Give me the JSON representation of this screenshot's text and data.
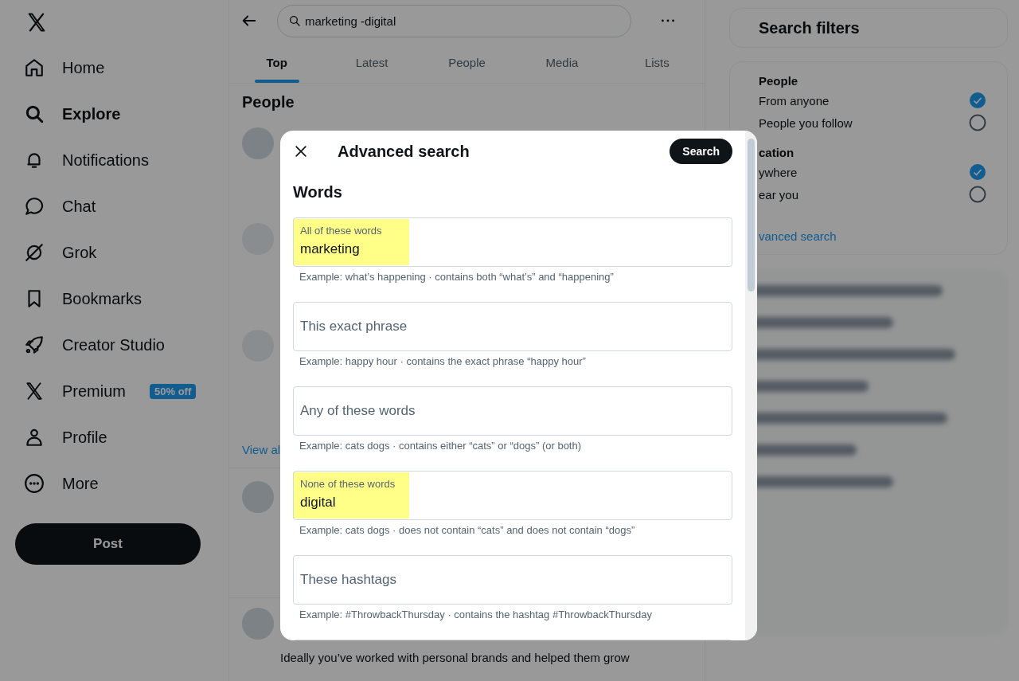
{
  "sidebar": {
    "items": [
      {
        "label": "Home",
        "selected": false
      },
      {
        "label": "Explore",
        "selected": true
      },
      {
        "label": "Notifications",
        "selected": false
      },
      {
        "label": "Chat",
        "selected": false
      },
      {
        "label": "Grok",
        "selected": false
      },
      {
        "label": "Bookmarks",
        "selected": false
      },
      {
        "label": "Creator Studio",
        "selected": false
      },
      {
        "label": "Premium",
        "selected": false,
        "badge": "50% off"
      },
      {
        "label": "Profile",
        "selected": false
      },
      {
        "label": "More",
        "selected": false
      }
    ],
    "post_button": "Post"
  },
  "search": {
    "value": "marketing -digital"
  },
  "tabs": [
    {
      "label": "Top",
      "selected": true
    },
    {
      "label": "Latest",
      "selected": false
    },
    {
      "label": "People",
      "selected": false
    },
    {
      "label": "Media",
      "selected": false
    },
    {
      "label": "Lists",
      "selected": false
    }
  ],
  "people": {
    "title": "People",
    "view_all_link": "View al"
  },
  "post_text": "Ideally you’ve worked with personal brands and helped them grow",
  "filters": {
    "title": "Search filters",
    "groups": [
      {
        "title": "People",
        "options": [
          {
            "label": "From anyone",
            "selected": true
          },
          {
            "label": "People you follow",
            "selected": false
          }
        ]
      },
      {
        "title": "cation",
        "options": [
          {
            "label": "ywhere",
            "selected": true
          },
          {
            "label": "ear you",
            "selected": false
          }
        ]
      }
    ],
    "advanced_link": "vanced search"
  },
  "modal": {
    "title": "Advanced search",
    "search_button": "Search",
    "section": "Words",
    "fields": [
      {
        "label": "All of these words",
        "value": "marketing",
        "highlighted": true,
        "hint": "Example: what’s happening · contains both “what’s” and “happening”"
      },
      {
        "placeholder": "This exact phrase",
        "highlighted": false,
        "hint": "Example: happy hour · contains the exact phrase “happy hour”"
      },
      {
        "placeholder": "Any of these words",
        "highlighted": false,
        "hint": "Example: cats dogs · contains either “cats” or “dogs” (or both)"
      },
      {
        "label": "None of these words",
        "value": "digital",
        "highlighted": true,
        "hint": "Example: cats dogs · does not contain “cats” and does not contain “dogs”"
      },
      {
        "placeholder": "These hashtags",
        "highlighted": false,
        "hint": "Example: #ThrowbackThursday · contains the hashtag #ThrowbackThursday"
      }
    ]
  }
}
